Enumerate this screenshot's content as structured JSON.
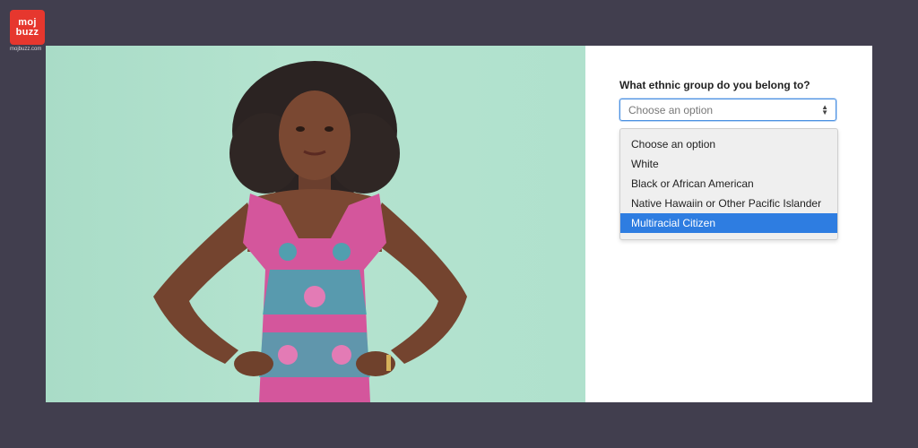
{
  "brand": {
    "logo_line1": "moj",
    "logo_line2": "buzz",
    "url": "mojbuzz.com"
  },
  "form": {
    "question": "What ethnic group do you belong to?",
    "select_value": "Choose an option",
    "options": [
      {
        "label": "Choose an option",
        "selected": false
      },
      {
        "label": "White",
        "selected": false
      },
      {
        "label": "Black or African American",
        "selected": false
      },
      {
        "label": "Native Hawaiin or Other Pacific Islander",
        "selected": false
      },
      {
        "label": "Multiracial Citizen",
        "selected": true
      }
    ]
  },
  "colors": {
    "highlight": "#2e7de1",
    "focus_border": "#4a90e2",
    "brand": "#e6372e"
  }
}
